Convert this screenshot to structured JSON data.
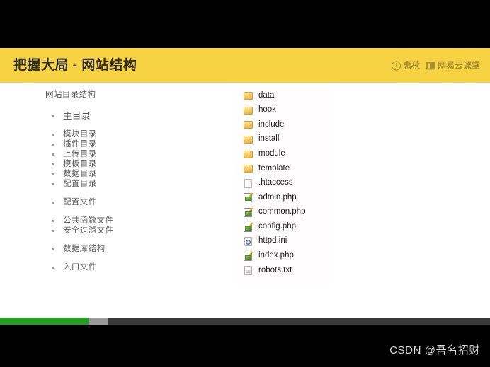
{
  "slide": {
    "title": "把握大局 - 网站结构",
    "brand": {
      "partner_label": "惠秋",
      "platform_label": "网易云课堂",
      "partner_mark_glyph": "ⓘ",
      "accent_color": "#f7d344",
      "text_color": "#6d5a17"
    },
    "outline": {
      "heading": "网站目录结构",
      "groups": [
        {
          "items": [
            {
              "label": "主目录",
              "level": 1
            }
          ]
        },
        {
          "items": [
            {
              "label": "模块目录",
              "level": 2
            },
            {
              "label": "插件目录",
              "level": 2
            },
            {
              "label": "上传目录",
              "level": 2
            },
            {
              "label": "模板目录",
              "level": 2
            },
            {
              "label": "数据目录",
              "level": 2
            },
            {
              "label": "配置目录",
              "level": 2
            }
          ]
        },
        {
          "items": [
            {
              "label": "配置文件",
              "level": 2
            }
          ]
        },
        {
          "items": [
            {
              "label": "公共函数文件",
              "level": 2
            },
            {
              "label": "安全过滤文件",
              "level": 2
            }
          ]
        },
        {
          "items": [
            {
              "label": "数据库结构",
              "level": 2
            }
          ]
        },
        {
          "items": [
            {
              "label": "入口文件",
              "level": 2
            }
          ]
        }
      ]
    },
    "filelist": {
      "rows": [
        {
          "name": "data",
          "icon": "folder-icon",
          "type": "folder"
        },
        {
          "name": "hook",
          "icon": "folder-icon",
          "type": "folder"
        },
        {
          "name": "include",
          "icon": "folder-icon",
          "type": "folder"
        },
        {
          "name": "install",
          "icon": "folder-icon",
          "type": "folder"
        },
        {
          "name": "module",
          "icon": "folder-icon",
          "type": "folder"
        },
        {
          "name": "template",
          "icon": "folder-icon",
          "type": "folder"
        },
        {
          "name": ".htaccess",
          "icon": "blank-document-icon",
          "type": "doc"
        },
        {
          "name": "admin.php",
          "icon": "php-editor-file-icon",
          "type": "php"
        },
        {
          "name": "common.php",
          "icon": "php-editor-file-icon",
          "type": "php"
        },
        {
          "name": "config.php",
          "icon": "php-editor-file-icon",
          "type": "php"
        },
        {
          "name": "httpd.ini",
          "icon": "ini-settings-file-icon",
          "type": "ini"
        },
        {
          "name": "index.php",
          "icon": "php-editor-file-icon",
          "type": "php"
        },
        {
          "name": "robots.txt",
          "icon": "text-document-icon",
          "type": "txt"
        }
      ]
    }
  },
  "player": {
    "progress": {
      "played_percent": 18,
      "buffered_percent": 22,
      "played_color": "#21a31f",
      "buffered_color": "#9a9a9a",
      "track_color": "#3a3a3a"
    }
  },
  "watermark": {
    "text": "CSDN @吾名招财"
  }
}
